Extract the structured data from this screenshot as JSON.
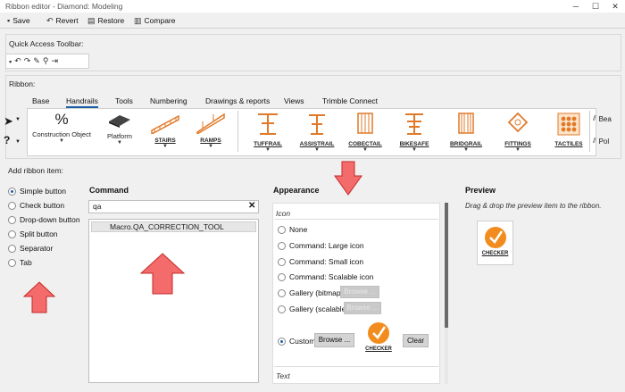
{
  "window": {
    "title": "Ribbon editor - Diamond: Modeling",
    "controls": [
      "minimize-icon",
      "maximize-icon",
      "close-icon"
    ]
  },
  "toolbar": {
    "save": "Save",
    "revert": "Revert",
    "restore": "Restore",
    "compare": "Compare"
  },
  "qat": {
    "label": "Quick Access Toolbar:",
    "icons": [
      "save-icon",
      "undo-icon",
      "redo-icon",
      "pencil-icon",
      "wand-icon",
      "export-icon"
    ]
  },
  "ribbon": {
    "label": "Ribbon:",
    "tabs": [
      "Base",
      "Handrails",
      "Tools",
      "Numbering",
      "Drawings & reports",
      "Views",
      "Trimble Connect"
    ],
    "active_tab": "Handrails",
    "buttons": [
      "Construction Object",
      "Platform",
      "STAIRS",
      "RAMPS",
      "TUFFRAIL",
      "ASSISTRAIL",
      "COBECTAIL",
      "BIKESAFE",
      "BRIDGRAIL",
      "FITTINGS",
      "TACTILES",
      "Bea",
      "Pol"
    ]
  },
  "add_item": {
    "label": "Add ribbon item:",
    "options": [
      "Simple button",
      "Check button",
      "Drop-down button",
      "Split button",
      "Separator",
      "Tab"
    ],
    "selected": "Simple button"
  },
  "command": {
    "title": "Command",
    "search_value": "qa",
    "results": [
      "Macro.QA_CORRECTION_TOOL"
    ]
  },
  "appearance": {
    "title": "Appearance",
    "icon_section": "Icon",
    "options": [
      "None",
      "Command: Large icon",
      "Command: Small icon",
      "Command: Scalable icon",
      "Gallery (bitmap)",
      "Gallery (scalable)",
      "Custom"
    ],
    "selected": "Custom",
    "browse": "Browse ...",
    "clear": "Clear",
    "text_section": "Text",
    "icon_label": "CHECKER"
  },
  "preview": {
    "title": "Preview",
    "hint": "Drag & drop the preview item to the ribbon.",
    "item_label": "CHECKER"
  },
  "colors": {
    "accent": "#1c5fa8",
    "orange": "#f28c1e",
    "annotation": "#e53935"
  }
}
